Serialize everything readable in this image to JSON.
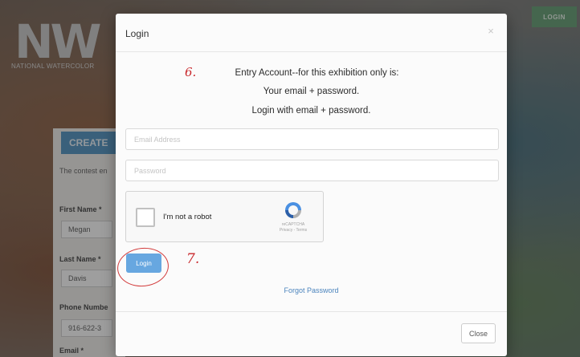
{
  "background": {
    "logo": "NW",
    "logo_subtitle": "NATIONAL WATERCOLOR",
    "header_login_label": "LOGIN",
    "create_heading": "CREATE",
    "intro_text": "The contest en",
    "fields": [
      {
        "label": "First Name *",
        "value": "Megan"
      },
      {
        "label": "Last Name *",
        "value": "Davis"
      },
      {
        "label": "Phone Numbe",
        "value": "916-622-3"
      },
      {
        "label": "Email *",
        "value": ""
      }
    ]
  },
  "modal": {
    "title": "Login",
    "close_icon": "×",
    "instructions": [
      "Entry Account--for this exhibition only is:",
      "Your email + password.",
      "Login with email + password."
    ],
    "email_placeholder": "Email Address",
    "password_placeholder": "Password",
    "recaptcha": {
      "label": "I'm not a robot",
      "brand": "reCAPTCHA",
      "terms": "Privacy - Terms"
    },
    "login_button": "Login",
    "forgot_link": "Forgot Password",
    "close_button": "Close"
  },
  "annotations": {
    "step_six": "6.",
    "step_seven": "7.",
    "color": "#c8262a"
  }
}
